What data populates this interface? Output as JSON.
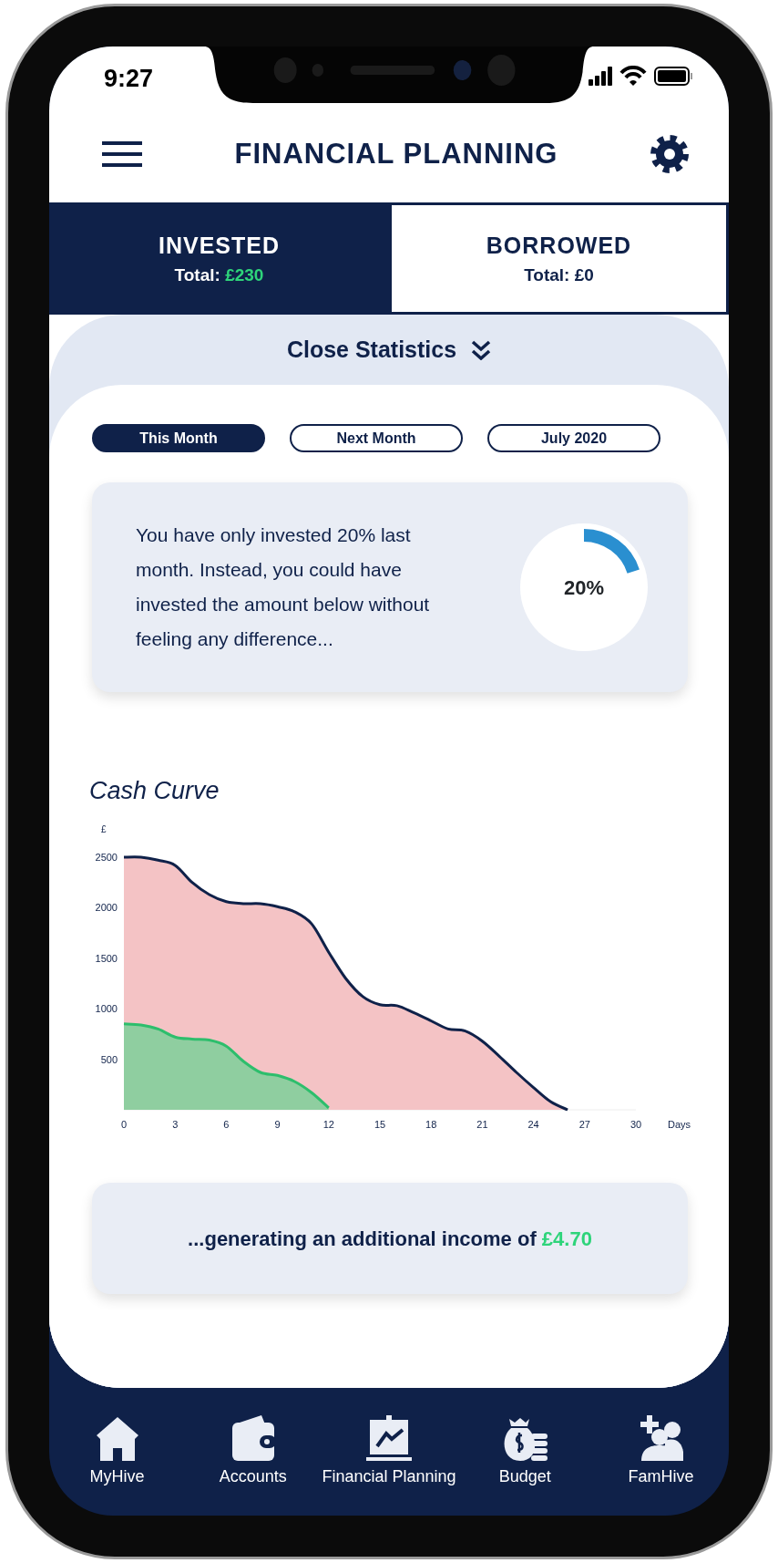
{
  "status_bar": {
    "time": "9:27"
  },
  "header": {
    "title": "FINANCIAL PLANNING"
  },
  "tabs": [
    {
      "label": "INVESTED",
      "total_label": "Total:",
      "total": "£230",
      "selected": true
    },
    {
      "label": "BORROWED",
      "total_label": "Total:",
      "total": "£0",
      "selected": false
    }
  ],
  "statistics": {
    "toggle_label": "Close Statistics",
    "expanded": true,
    "periods": [
      {
        "label": "This Month",
        "selected": true
      },
      {
        "label": "Next Month",
        "selected": false
      },
      {
        "label": "July 2020",
        "selected": false
      }
    ],
    "insight": {
      "text": "You have only invested 20% last month. Instead, you could have invested the amount below without feeling any difference...",
      "level": 0.2,
      "reading": "20%"
    },
    "chart_data": {
      "type": "area",
      "title": "Cash Curve",
      "xlabel": "Days",
      "ylabel": "£",
      "x": [
        0,
        1,
        2,
        3,
        4,
        5,
        6,
        7,
        8,
        9,
        10,
        11,
        12,
        13,
        14,
        15,
        16,
        17,
        18,
        19,
        20,
        21,
        22,
        23,
        24,
        25,
        26
      ],
      "series": [
        {
          "color": "#f4c3c5",
          "values": [
            2500,
            2500,
            2470,
            2420,
            2250,
            2130,
            2060,
            2040,
            2040,
            2010,
            1960,
            1840,
            1560,
            1300,
            1120,
            1040,
            1030,
            960,
            880,
            800,
            780,
            680,
            530,
            370,
            220,
            80,
            0
          ]
        },
        {
          "color": "#8fcea0",
          "values": [
            850,
            840,
            800,
            720,
            700,
            690,
            630,
            480,
            370,
            340,
            280,
            170,
            20,
            null,
            null,
            null,
            null,
            null,
            null,
            null,
            null,
            null,
            null,
            null,
            null,
            null,
            null
          ]
        }
      ],
      "xlim": [
        0,
        30
      ],
      "ylim": [
        0,
        2500
      ],
      "xticks": [
        0,
        3,
        6,
        9,
        12,
        15,
        18,
        21,
        24,
        27,
        30
      ],
      "yticks": [
        500,
        1000,
        1500,
        2000,
        2500
      ]
    },
    "income": {
      "text": "...generating an additional income of",
      "amount": "£4.70"
    }
  },
  "nav": [
    {
      "label": "MyHive"
    },
    {
      "label": "Accounts"
    },
    {
      "label": "Financial Planning"
    },
    {
      "label": "Budget"
    },
    {
      "label": "FamHive"
    }
  ]
}
